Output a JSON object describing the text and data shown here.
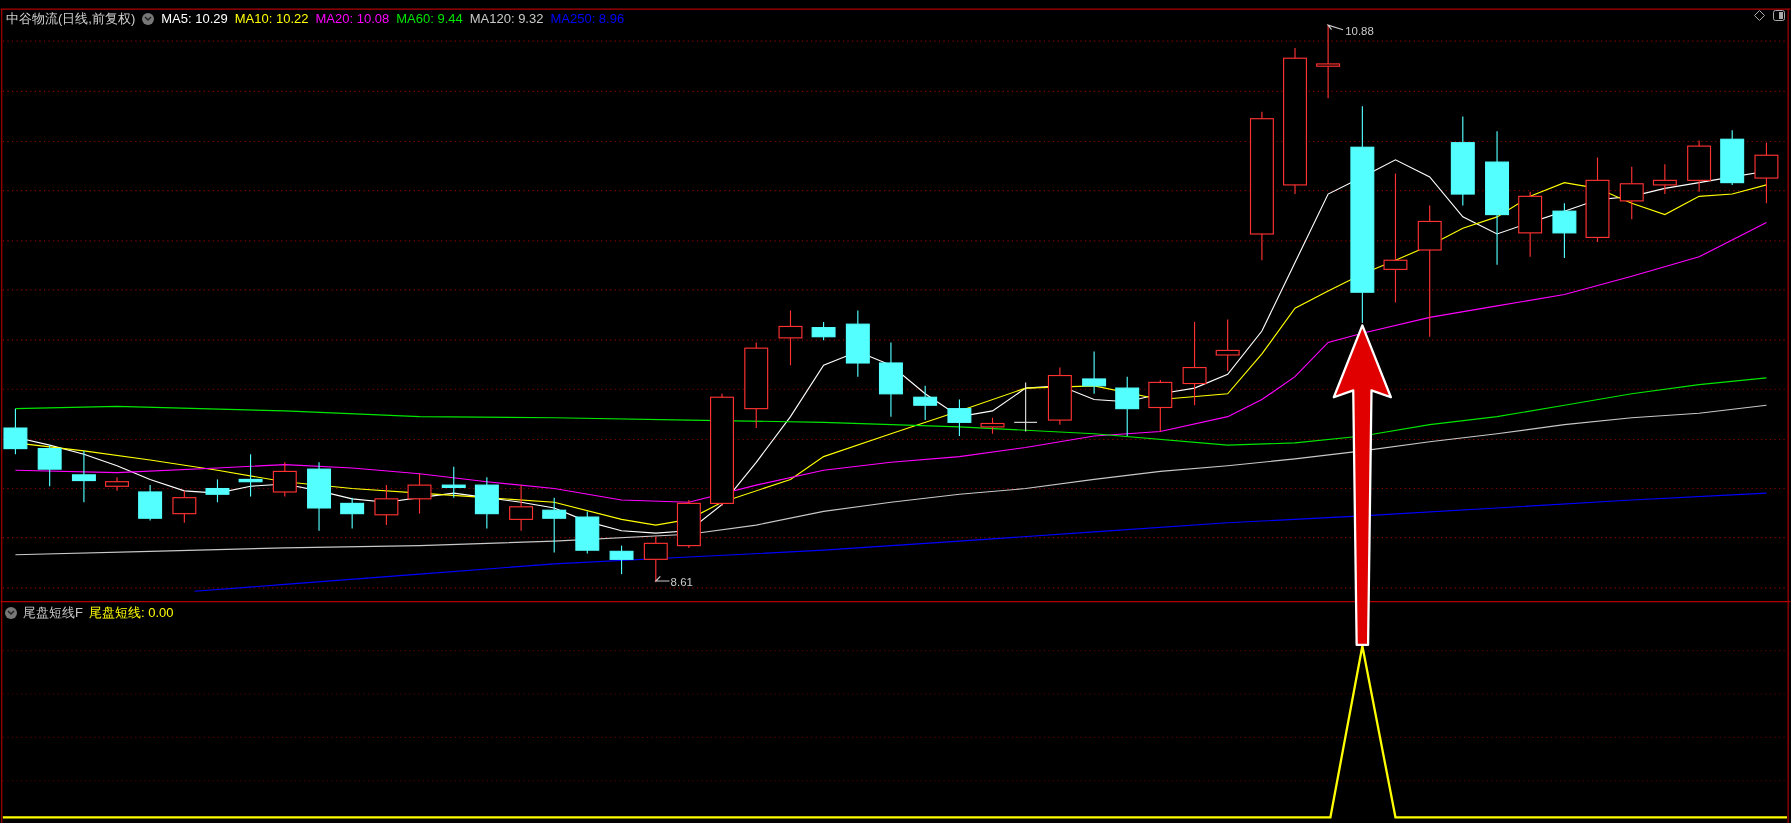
{
  "main_chart": {
    "title": "中谷物流(日线,前复权)",
    "moving_averages": [
      {
        "label": "MA5: 10.29",
        "color": "#ffffff"
      },
      {
        "label": "MA10: 10.22",
        "color": "#ffff00"
      },
      {
        "label": "MA20: 10.08",
        "color": "#ff00ff"
      },
      {
        "label": "MA60: 9.44",
        "color": "#00e600"
      },
      {
        "label": "MA120: 9.32",
        "color": "#c8c8c8"
      },
      {
        "label": "MA250: 8.96",
        "color": "#0000ff"
      }
    ],
    "high_label": "10.88",
    "low_label": "8.61"
  },
  "indicator": {
    "name": "尾盘短线F",
    "value_label": "尾盘短线: 0.00"
  }
}
